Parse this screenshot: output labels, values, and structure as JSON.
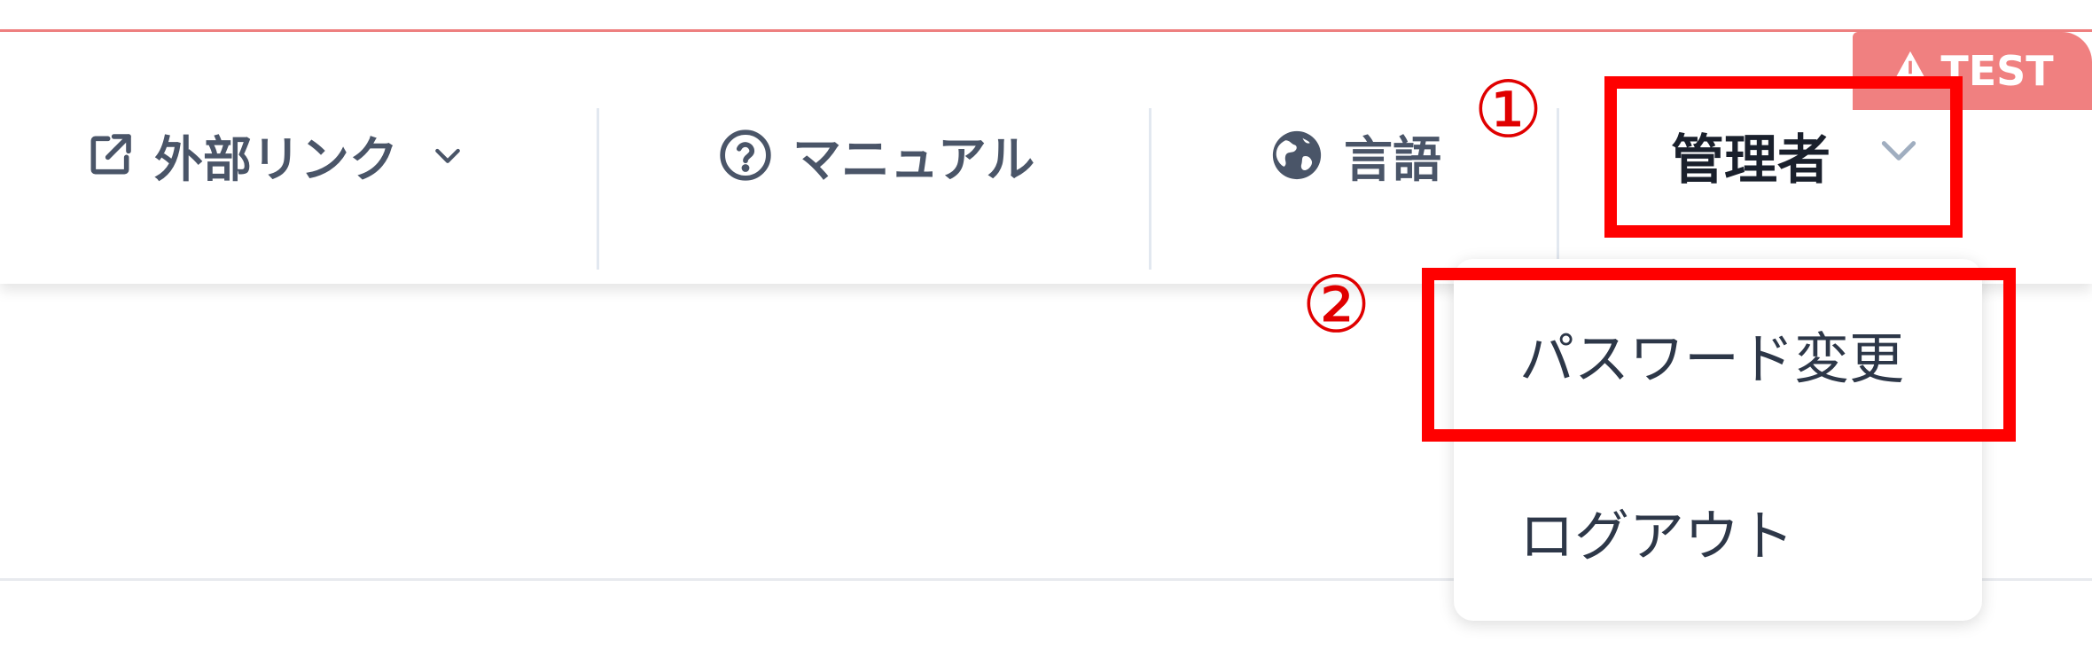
{
  "header": {
    "external_links": {
      "label": "外部リンク",
      "icon": "external-link-icon"
    },
    "manual": {
      "label": "マニュアル",
      "icon": "question-circle-icon"
    },
    "language": {
      "label": "言語",
      "icon": "globe-icon"
    },
    "user": {
      "label": "管理者",
      "icon": "chevron-down-icon"
    },
    "env_badge": "TEST"
  },
  "dropdown": {
    "items": [
      {
        "label": "パスワード変更"
      },
      {
        "label": "ログアウト"
      }
    ]
  },
  "annotations": {
    "step1": "①",
    "step2": "②"
  },
  "colors": {
    "accent": "#f08080",
    "annotation_red": "#ff0000",
    "text": "#4a5568"
  }
}
